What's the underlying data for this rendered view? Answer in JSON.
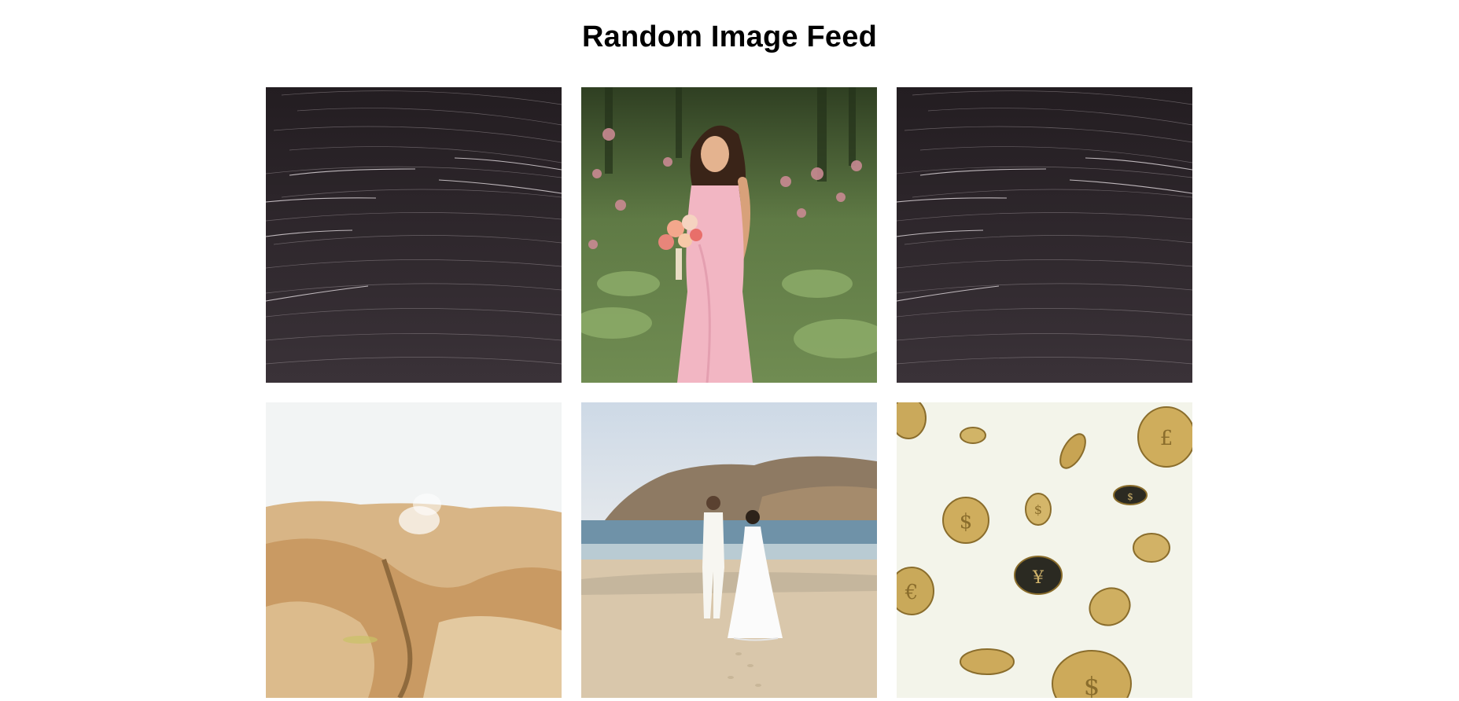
{
  "header": {
    "title": "Random Image Feed"
  },
  "feed": {
    "images": [
      {
        "subject": "star-trails-night-sky"
      },
      {
        "subject": "woman-pink-dress-flowers"
      },
      {
        "subject": "star-trails-night-sky"
      },
      {
        "subject": "desert-geothermal-landscape"
      },
      {
        "subject": "couple-walking-beach"
      },
      {
        "subject": "falling-gold-coins"
      }
    ]
  }
}
